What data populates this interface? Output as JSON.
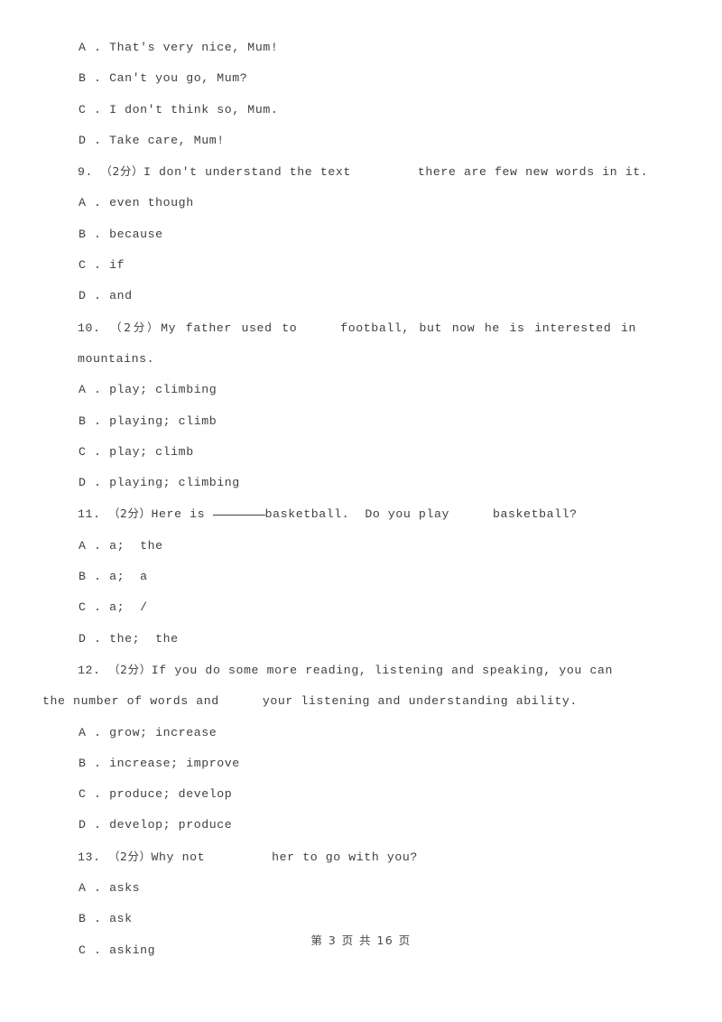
{
  "page": {
    "background_color": "#ffffff",
    "text_color": "#3f3f3f",
    "footer": "第 3 页 共 16 页"
  },
  "content": {
    "orphan_options": [
      {
        "marker": "A .",
        "text": "That's very nice, Mum!"
      },
      {
        "marker": "B .",
        "text": "Can't you go, Mum?"
      },
      {
        "marker": "C .",
        "text": "I don't think so, Mum."
      },
      {
        "marker": "D .",
        "text": "Take care, Mum!"
      }
    ],
    "questions": [
      {
        "number": "9.",
        "score": "（2分）",
        "stem_part_1": "I don't understand the text",
        "stem_part_2": "there are few new words in it.",
        "options": [
          {
            "marker": "A .",
            "text": "even though"
          },
          {
            "marker": "B .",
            "text": "because"
          },
          {
            "marker": "C .",
            "text": "if"
          },
          {
            "marker": "D .",
            "text": "and"
          }
        ]
      },
      {
        "number": "10.",
        "score": "（2分）",
        "stem_part_1": "My father used to",
        "stem_part_2": "football, but now he is interested in",
        "stem_part_3": "mountains.",
        "options": [
          {
            "marker": "A .",
            "text": "play; climbing"
          },
          {
            "marker": "B .",
            "text": "playing; climb"
          },
          {
            "marker": "C .",
            "text": "play; climb"
          },
          {
            "marker": "D .",
            "text": "playing; climbing"
          }
        ]
      },
      {
        "number": "11.",
        "score": "（2分）",
        "stem_part_1": "Here is",
        "stem_part_2": "basketball.  Do you play",
        "stem_part_3": "basketball?",
        "options": [
          {
            "marker": "A .",
            "text": "a;  the"
          },
          {
            "marker": "B .",
            "text": "a;  a"
          },
          {
            "marker": "C .",
            "text": "a;  /"
          },
          {
            "marker": "D .",
            "text": "the;  the"
          }
        ]
      },
      {
        "number": "12.",
        "score": "（2分）",
        "stem_part_1": "If you do some more reading, listening and speaking, you can",
        "stem_part_2": "the number of words and",
        "stem_part_3": "your listening and understanding ability.",
        "options": [
          {
            "marker": "A .",
            "text": "grow; increase"
          },
          {
            "marker": "B .",
            "text": "increase; improve"
          },
          {
            "marker": "C .",
            "text": "produce; develop"
          },
          {
            "marker": "D .",
            "text": "develop; produce"
          }
        ]
      },
      {
        "number": "13.",
        "score": "（2分）",
        "stem_part_1": "Why not",
        "stem_part_2": "her to go with you?",
        "options": [
          {
            "marker": "A .",
            "text": "asks"
          },
          {
            "marker": "B .",
            "text": "ask"
          },
          {
            "marker": "C .",
            "text": "asking"
          }
        ]
      }
    ]
  }
}
